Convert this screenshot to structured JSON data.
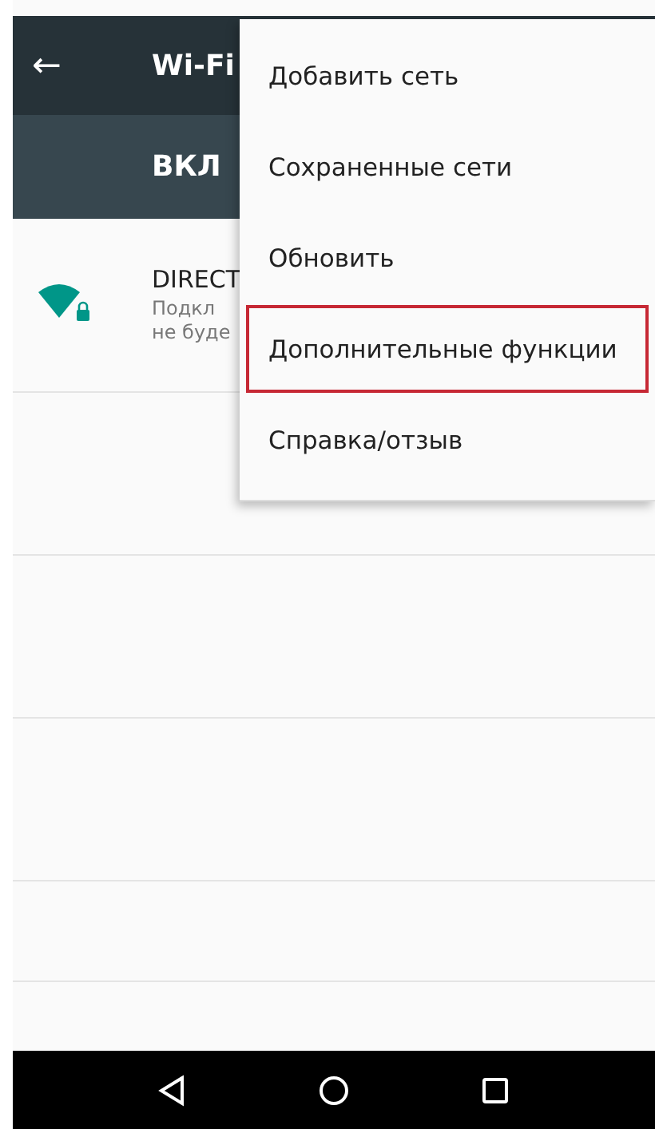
{
  "toolbar": {
    "back_icon": "←",
    "title": "Wi-Fi"
  },
  "switch_bar": {
    "label": "ВКЛ"
  },
  "networks": [
    {
      "name": "DIRECT",
      "summary_lines": [
        "Подкл",
        "не буде"
      ],
      "secured": true
    }
  ],
  "menu": {
    "items": [
      {
        "label": "Добавить сеть",
        "highlighted": false
      },
      {
        "label": "Сохраненные сети",
        "highlighted": false
      },
      {
        "label": "Обновить",
        "highlighted": false
      },
      {
        "label": "Дополнительные функции",
        "highlighted": true
      },
      {
        "label": "Справка/отзыв",
        "highlighted": false
      }
    ]
  }
}
